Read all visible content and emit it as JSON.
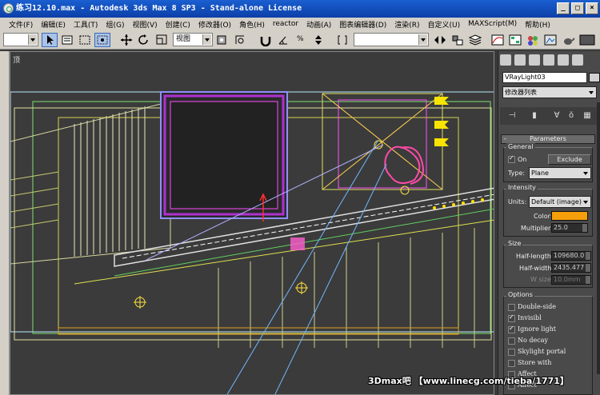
{
  "window": {
    "title": "练习12.10.max - Autodesk 3ds Max 8 SP3 - Stand-alone License",
    "buttons": [
      "_",
      "□",
      "×"
    ]
  },
  "menu": [
    "文件(F)",
    "编辑(E)",
    "工具(T)",
    "组(G)",
    "视图(V)",
    "创建(C)",
    "修改器(O)",
    "角色(H)",
    "reactor",
    "动画(A)",
    "图表编辑器(D)",
    "渲染(R)",
    "自定义(U)",
    "MAXScript(M)",
    "帮助(H)"
  ],
  "toolbar": {
    "view_dropdown": "视图",
    "named_selection": ""
  },
  "viewport": {
    "label": "顶"
  },
  "panel": {
    "object_name": "VRayLight03",
    "object_color": "#d0d0d0",
    "modifier_list": "修改器列表",
    "rollout_title": "Parameters",
    "general": {
      "title": "General",
      "on_label": "On",
      "exclude_label": "Exclude",
      "type_label": "Type:",
      "type_value": "Plane"
    },
    "intensity": {
      "title": "Intensity",
      "units_label": "Units:",
      "units_value": "Default (image)",
      "color_label": "Color:",
      "color_value": "#f5a00a",
      "multiplier_label": "Multiplier:",
      "multiplier_value": "25.0"
    },
    "size": {
      "title": "Size",
      "half_length_label": "Half-length:",
      "half_length_value": "109680.0",
      "half_width_label": "Half-width:",
      "half_width_value": "2435.477",
      "w_size_label": "W size",
      "w_size_value": "10.0mm"
    },
    "options": {
      "title": "Options",
      "items": [
        {
          "label": "Double-side",
          "checked": false
        },
        {
          "label": "Invisibl",
          "checked": true
        },
        {
          "label": "Ignore light",
          "checked": true
        },
        {
          "label": "No decay",
          "checked": false
        },
        {
          "label": "Skylight portal",
          "checked": false
        },
        {
          "label": "Store with",
          "checked": false
        },
        {
          "label": "Affect",
          "checked": false
        },
        {
          "label": "Affect",
          "checked": false
        }
      ]
    }
  },
  "watermark": "3Dmax吧 【www.linecg.com/tieba/1771】"
}
